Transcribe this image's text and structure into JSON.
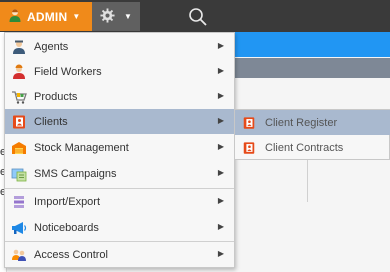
{
  "topbar": {
    "admin_label": "ADMIN",
    "admin_icon": "user-icon",
    "settings_icon": "gear-icon",
    "search_icon": "search-icon"
  },
  "colors": {
    "admin_orange": "#f08a1a",
    "topbar_dark": "#3a3a3a",
    "highlight": "#a9b9cf",
    "header_blue": "#2196f3"
  },
  "left_edge_chars": [
    "e",
    "e",
    "e"
  ],
  "menu": {
    "items": [
      {
        "label": "Agents",
        "icon": "agent-icon"
      },
      {
        "label": "Field Workers",
        "icon": "field-worker-icon"
      },
      {
        "label": "Products",
        "icon": "products-cart-icon"
      },
      {
        "label": "Clients",
        "icon": "client-book-icon",
        "active": true
      },
      {
        "label": "Stock Management",
        "icon": "stock-box-icon"
      },
      {
        "label": "SMS Campaigns",
        "icon": "sms-icon"
      },
      {
        "label": "Import/Export",
        "icon": "import-export-icon"
      },
      {
        "label": "Noticeboards",
        "icon": "megaphone-icon"
      },
      {
        "label": "Access Control",
        "icon": "access-users-icon"
      }
    ]
  },
  "submenu": {
    "items": [
      {
        "label": "Client Register",
        "icon": "client-book-icon",
        "active": true
      },
      {
        "label": "Client Contracts",
        "icon": "client-book-icon"
      }
    ]
  }
}
